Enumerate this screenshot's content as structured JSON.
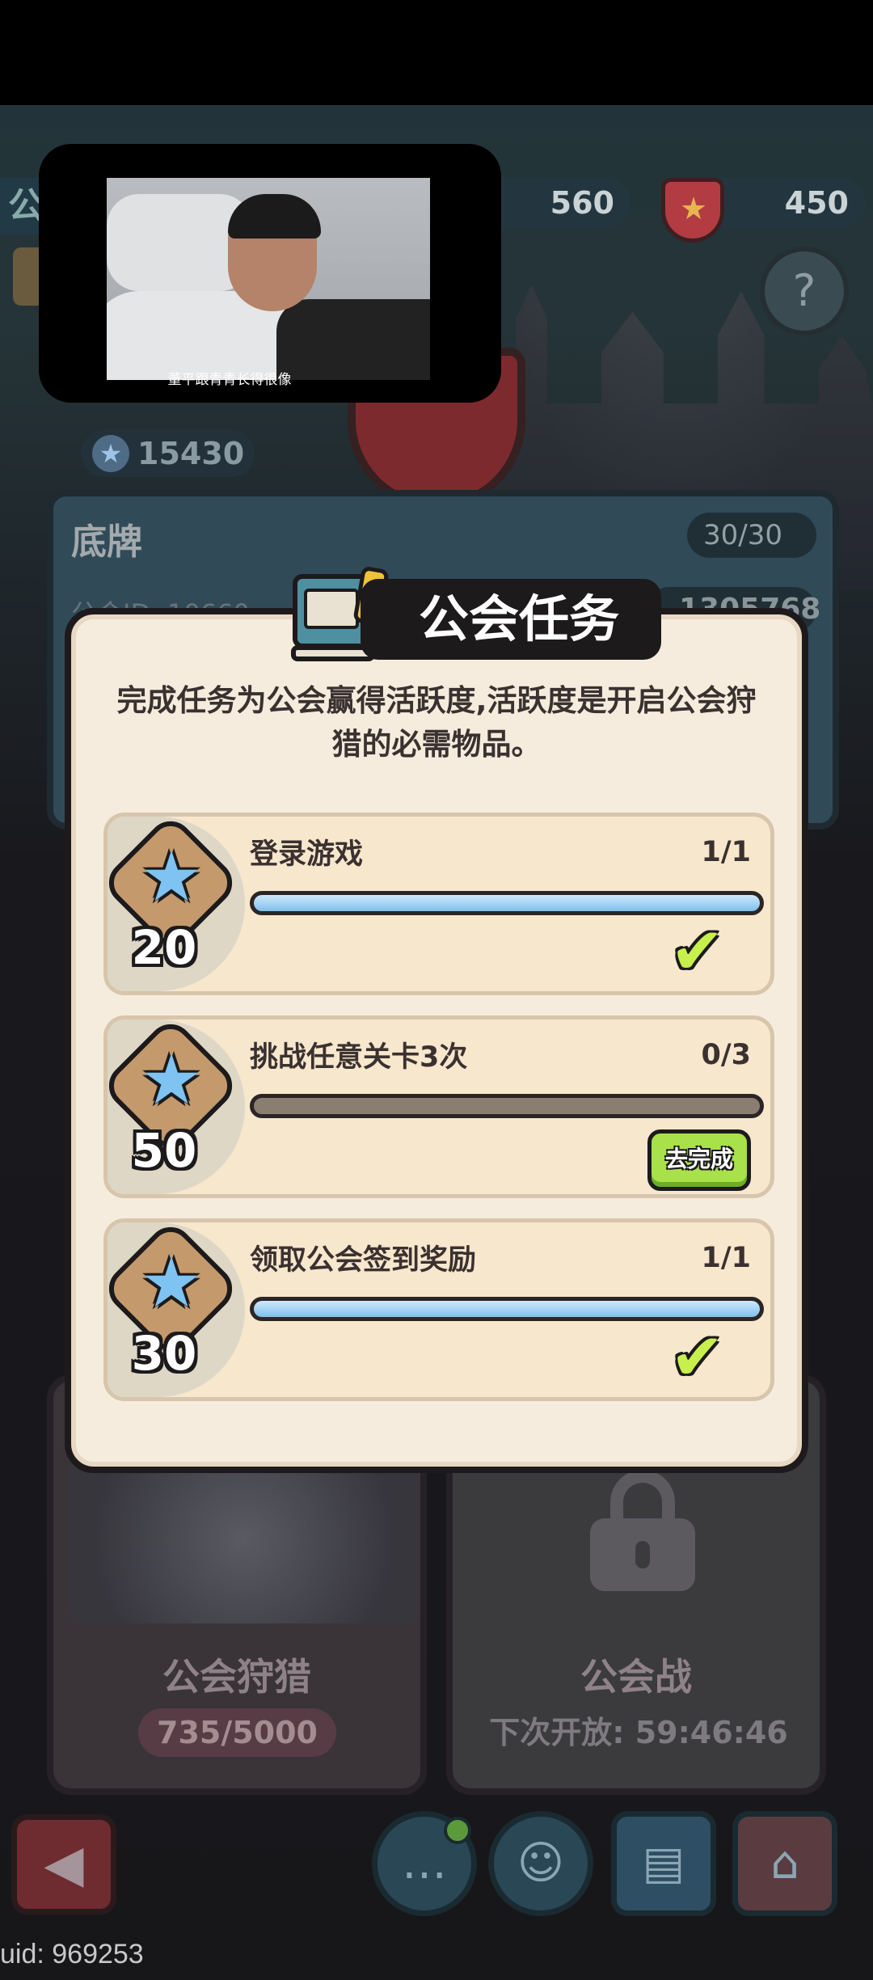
{
  "top_bar": {
    "resource_1": "560",
    "resource_2": "450"
  },
  "guild": {
    "score": "15430",
    "name": "底牌",
    "members": "30/30",
    "id_label": "公会ID: 10660",
    "power": "1305768"
  },
  "video": {
    "caption": "董平跟青青长得很像"
  },
  "modal": {
    "title": "公会任务",
    "description": "完成任务为公会赢得活跃度,活跃度是开启公会狩猎的必需物品。",
    "tasks": [
      {
        "reward": "20",
        "name": "登录游戏",
        "progress_text": "1/1",
        "progress": 1.0,
        "status": "completed"
      },
      {
        "reward": "50",
        "name": "挑战任意关卡3次",
        "progress_text": "0/3",
        "progress": 0.0,
        "status": "pending",
        "action_label": "去完成"
      },
      {
        "reward": "30",
        "name": "领取公会签到奖励",
        "progress_text": "1/1",
        "progress": 1.0,
        "status": "completed"
      }
    ]
  },
  "features": {
    "hunt": {
      "title": "公会狩猎",
      "progress": "735/5000"
    },
    "war": {
      "title": "公会战",
      "subtitle": "下次开放: 59:46:46"
    }
  },
  "footer": {
    "uid": "uid: 969253"
  },
  "colors": {
    "accent_green": "#a9e14a",
    "progress_blue": "#9fd0f4",
    "modal_bg": "#f6ecdd",
    "dark_outline": "#1d1a1c"
  }
}
